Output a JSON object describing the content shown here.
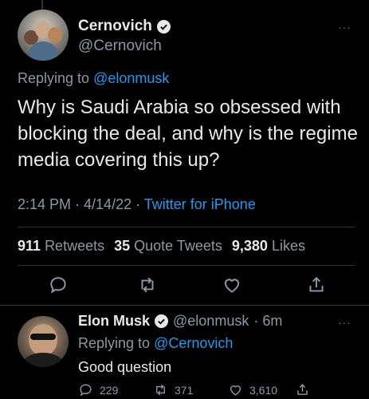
{
  "tweet": {
    "author": {
      "name": "Cernovich",
      "handle": "@Cernovich",
      "avatar_icon": "profile-photo"
    },
    "replying_prefix": "Replying to",
    "replying_to": "@elonmusk",
    "text": "Why is Saudi Arabia so obsessed with blocking the deal, and why is the regime media covering this up?",
    "time": "2:14 PM · 4/14/22 · ",
    "client": "Twitter for iPhone",
    "stats": {
      "retweets_count": "911",
      "retweets_label": "Retweets",
      "quotes_count": "35",
      "quotes_label": "Quote Tweets",
      "likes_count": "9,380",
      "likes_label": "Likes"
    },
    "more_label": "···"
  },
  "reply": {
    "author": {
      "name": "Elon Musk",
      "handle": "@elonmusk",
      "time": "· 6m",
      "avatar_icon": "profile-photo"
    },
    "replying_prefix": "Replying to",
    "replying_to": "@Cernovich",
    "text": "Good question",
    "counts": {
      "replies": "229",
      "retweets": "371",
      "likes": "3,610"
    },
    "more_label": "···"
  },
  "colors": {
    "background": "#000000",
    "text": "#e7e9ea",
    "muted": "#8b98a5",
    "accent": "#1d9bf0",
    "divider": "#2f3336"
  }
}
